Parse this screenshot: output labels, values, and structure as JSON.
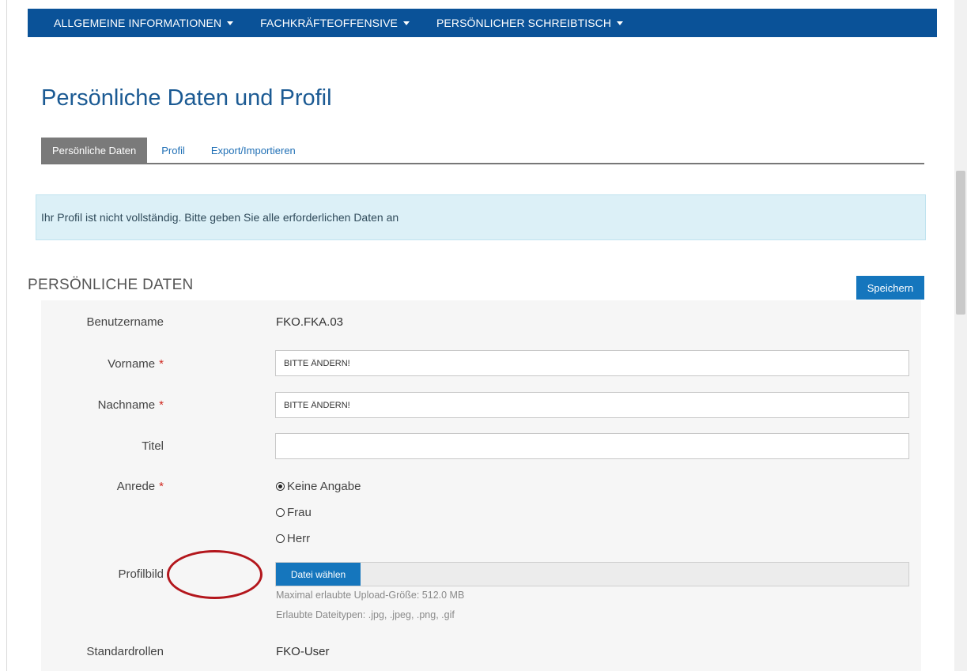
{
  "nav": {
    "items": [
      {
        "label": "ALLGEMEINE INFORMATIONEN"
      },
      {
        "label": "FACHKRÄFTEOFFENSIVE"
      },
      {
        "label": "PERSÖNLICHER SCHREIBTISCH"
      }
    ]
  },
  "page": {
    "title": "Persönliche Daten und Profil"
  },
  "tabs": [
    {
      "label": "Persönliche Daten",
      "active": true
    },
    {
      "label": "Profil",
      "active": false
    },
    {
      "label": "Export/Importieren",
      "active": false
    }
  ],
  "alert": {
    "text": "Ihr Profil ist nicht vollständig. Bitte geben Sie alle erforderlichen Daten an"
  },
  "section": {
    "title": "PERSÖNLICHE DATEN",
    "save_label": "Speichern"
  },
  "form": {
    "required_mark": "*",
    "username": {
      "label": "Benutzername",
      "value": "FKO.FKA.03"
    },
    "firstname": {
      "label": "Vorname",
      "value": "BITTE ÄNDERN!"
    },
    "lastname": {
      "label": "Nachname",
      "value": "BITTE ÄNDERN!"
    },
    "title": {
      "label": "Titel",
      "value": ""
    },
    "salutation": {
      "label": "Anrede",
      "options": [
        {
          "label": "Keine Angabe",
          "checked": true
        },
        {
          "label": "Frau",
          "checked": false
        },
        {
          "label": "Herr",
          "checked": false
        }
      ]
    },
    "picture": {
      "label": "Profilbild",
      "button_label": "Datei wählen",
      "max_size": "Maximal erlaubte Upload-Größe: 512.0 MB",
      "file_types": "Erlaubte Dateitypen: .jpg, .jpeg, .png, .gif"
    },
    "roles": {
      "label": "Standardrollen",
      "value": "FKO-User"
    }
  },
  "colors": {
    "nav_bg": "#0a5298",
    "primary_button": "#1576bd",
    "title_blue": "#1b5a93",
    "alert_bg": "#dcf0f7",
    "required": "#d0281f",
    "annotation_ring": "#b3161c"
  }
}
